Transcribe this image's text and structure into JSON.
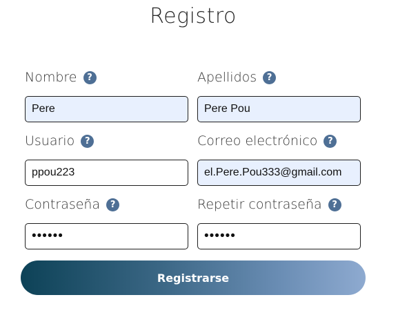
{
  "form": {
    "title": "Registro",
    "help_glyph": "?",
    "help_icon_color": "#4e6f95",
    "fields": {
      "nombre": {
        "label": "Nombre",
        "value": "Pere"
      },
      "apellidos": {
        "label": "Apellidos",
        "value": "Pere Pou"
      },
      "usuario": {
        "label": "Usuario",
        "value": "ppou223"
      },
      "correo": {
        "label": "Correo electrónico",
        "value": "el.Pere.Pou333@gmail.com"
      },
      "contrasena": {
        "label": "Contraseña",
        "value": "••••••"
      },
      "repetir": {
        "label": "Repetir contraseña",
        "value": "••••••"
      }
    },
    "submit_label": "Registrarse",
    "submit_gradient": [
      "#0d4257",
      "#8eaad0"
    ]
  }
}
